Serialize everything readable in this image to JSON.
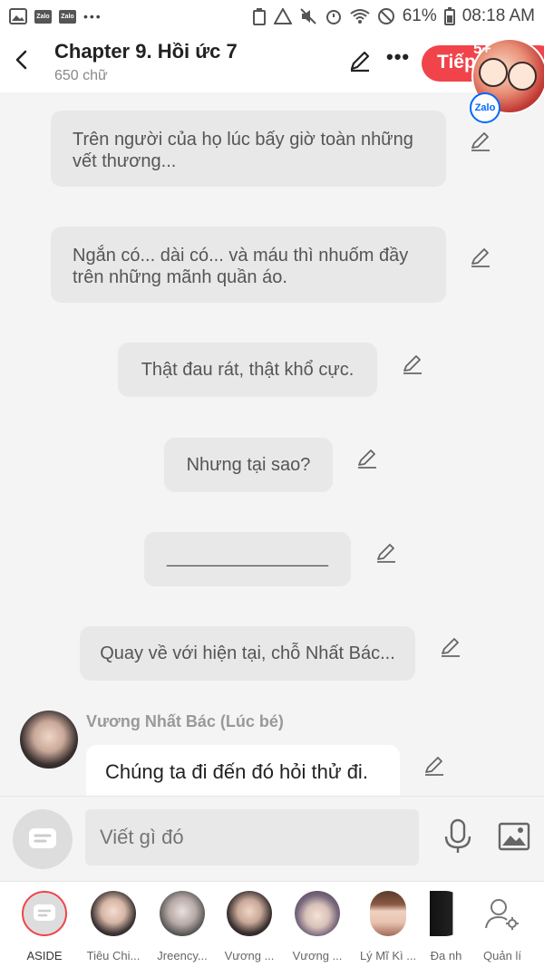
{
  "status_bar": {
    "battery": "61%",
    "time": "08:18 AM",
    "dots": "•••",
    "zalo1": "Zalo",
    "zalo2": "Zalo"
  },
  "header": {
    "title": "Chapter 9. Hồi ức 7",
    "subtitle": "650 chữ",
    "next_label": "Tiếp",
    "more": "•••"
  },
  "floating_bubble": {
    "badge_count": "5+",
    "brand": "Zalo"
  },
  "messages": [
    {
      "text": "Trên người của họ lúc bấy giờ toàn những vết thương..."
    },
    {
      "text": "Ngắn có... dài có... và máu thì nhuốm đầy trên những mãnh quần áo."
    },
    {
      "text": "Thật đau rát, thật khổ cực."
    },
    {
      "text": "Nhưng tại sao?"
    },
    {
      "text": "________________"
    },
    {
      "text": "Quay về với hiện tại, chỗ Nhất Bác..."
    },
    {
      "sender": "Vương Nhất Bác (Lúc bé)",
      "text": "Chúng ta đi đến đó hỏi thử đi."
    }
  ],
  "composer": {
    "placeholder": "Viết gì đó"
  },
  "tabs": [
    {
      "label": "ASIDE"
    },
    {
      "label": "Tiêu Chi..."
    },
    {
      "label": "Jreency..."
    },
    {
      "label": "Vương ..."
    },
    {
      "label": "Vương ..."
    },
    {
      "label": "Lý Mĩ Kì ..."
    },
    {
      "label": "Đa nh"
    },
    {
      "label": "Quản lí"
    }
  ],
  "colors": {
    "accent": "#f0444a",
    "zalo_blue": "#0068ff"
  }
}
